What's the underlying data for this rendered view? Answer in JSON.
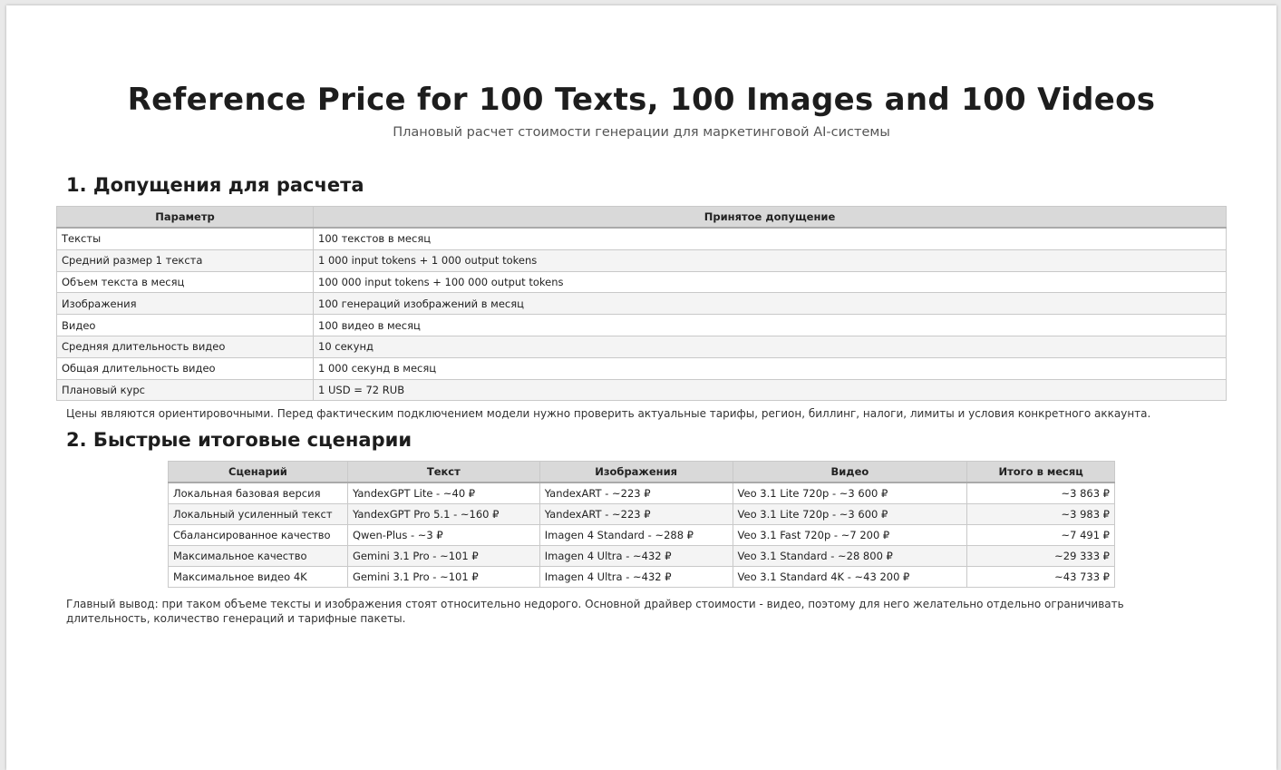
{
  "document": {
    "title": "Reference Price for 100 Texts, 100 Images and 100 Videos",
    "subtitle": "Плановый расчет стоимости генерации для маркетинговой AI-системы"
  },
  "section1": {
    "heading": "1. Допущения для расчета",
    "columns": [
      "Параметр",
      "Принятое допущение"
    ],
    "rows": [
      [
        "Тексты",
        "100 текстов в месяц"
      ],
      [
        "Средний размер 1 текста",
        "1 000 input tokens + 1 000 output tokens"
      ],
      [
        "Объем текста в месяц",
        "100 000 input tokens + 100 000 output tokens"
      ],
      [
        "Изображения",
        "100 генераций изображений в месяц"
      ],
      [
        "Видео",
        "100 видео в месяц"
      ],
      [
        "Средняя длительность видео",
        "10 секунд"
      ],
      [
        "Общая длительность видео",
        "1 000 секунд в месяц"
      ],
      [
        "Плановый курс",
        "1 USD = 72 RUB"
      ]
    ],
    "note": "Цены являются ориентировочными. Перед фактическим подключением модели нужно проверить актуальные тарифы, регион, биллинг, налоги, лимиты и условия конкретного аккаунта."
  },
  "section2": {
    "heading": "2. Быстрые итоговые сценарии",
    "columns": [
      "Сценарий",
      "Текст",
      "Изображения",
      "Видео",
      "Итого в месяц"
    ],
    "rows": [
      [
        "Локальная базовая версия",
        "YandexGPT Lite - ~40 ₽",
        "YandexART - ~223 ₽",
        "Veo 3.1 Lite 720p - ~3 600 ₽",
        "~3 863 ₽"
      ],
      [
        "Локальный усиленный текст",
        "YandexGPT Pro 5.1 - ~160 ₽",
        "YandexART - ~223 ₽",
        "Veo 3.1 Lite 720p - ~3 600 ₽",
        "~3 983 ₽"
      ],
      [
        "Сбалансированное качество",
        "Qwen-Plus - ~3 ₽",
        "Imagen 4 Standard - ~288 ₽",
        "Veo 3.1 Fast 720p - ~7 200 ₽",
        "~7 491 ₽"
      ],
      [
        "Максимальное качество",
        "Gemini 3.1 Pro - ~101 ₽",
        "Imagen 4 Ultra - ~432 ₽",
        "Veo 3.1 Standard - ~28 800 ₽",
        "~29 333 ₽"
      ],
      [
        "Максимальное видео 4K",
        "Gemini 3.1 Pro - ~101 ₽",
        "Imagen 4 Ultra - ~432 ₽",
        "Veo 3.1 Standard 4K - ~43 200 ₽",
        "~43 733 ₽"
      ]
    ],
    "note": "Главный вывод: при таком объеме тексты и изображения стоят относительно недорого. Основной драйвер стоимости - видео, поэтому для него желательно отдельно ограничивать длительность, количество генераций и тарифные пакеты."
  }
}
